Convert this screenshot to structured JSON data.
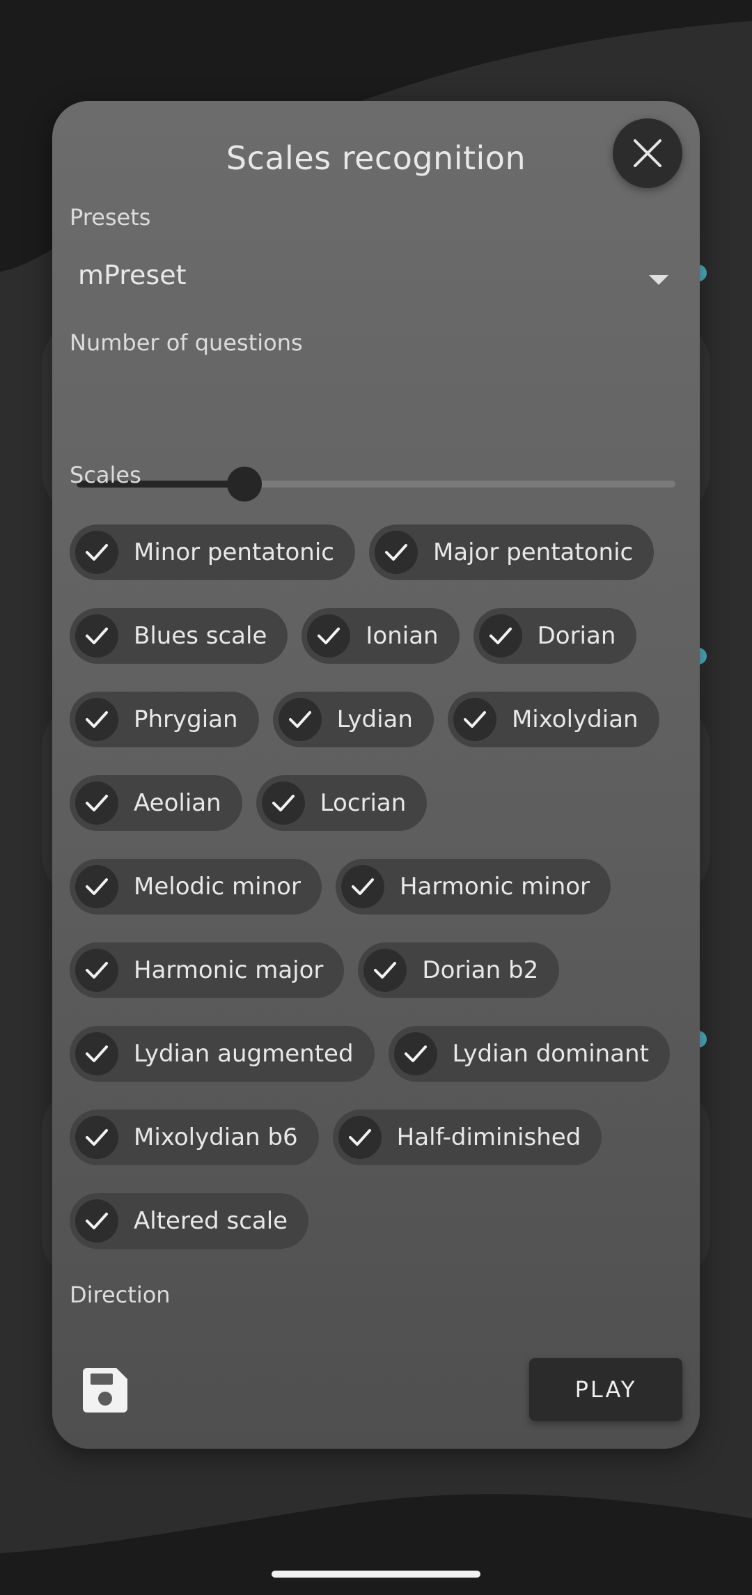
{
  "dialog": {
    "title": "Scales recognition",
    "presets_label": "Presets",
    "preset_value": "mPreset",
    "questions_label": "Number of questions",
    "questions_slider_fraction": 0.28,
    "scales_label": "Scales",
    "scales": [
      {
        "label": "Minor pentatonic",
        "checked": true
      },
      {
        "label": "Major pentatonic",
        "checked": true
      },
      {
        "label": "Blues scale",
        "checked": true
      },
      {
        "label": "Ionian",
        "checked": true
      },
      {
        "label": "Dorian",
        "checked": true
      },
      {
        "label": "Phrygian",
        "checked": true
      },
      {
        "label": "Lydian",
        "checked": true
      },
      {
        "label": "Mixolydian",
        "checked": true
      },
      {
        "label": "Aeolian",
        "checked": true
      },
      {
        "label": "Locrian",
        "checked": true
      },
      {
        "label": "Melodic minor",
        "checked": true
      },
      {
        "label": "Harmonic minor",
        "checked": true
      },
      {
        "label": "Harmonic major",
        "checked": true
      },
      {
        "label": "Dorian b2",
        "checked": true
      },
      {
        "label": "Lydian augmented",
        "checked": true
      },
      {
        "label": "Lydian dominant",
        "checked": true
      },
      {
        "label": "Mixolydian b6",
        "checked": true
      },
      {
        "label": "Half-diminished",
        "checked": true
      },
      {
        "label": "Altered scale",
        "checked": true
      }
    ],
    "direction_label": "Direction",
    "play_label": "PLAY"
  },
  "icons": {
    "close": "close-icon",
    "dropdown": "chevron-down-icon",
    "check": "check-icon",
    "save": "save-icon"
  },
  "colors": {
    "accent": "#4fb3c4",
    "dialog_bg": "#666666",
    "chip_bg": "#434343"
  }
}
